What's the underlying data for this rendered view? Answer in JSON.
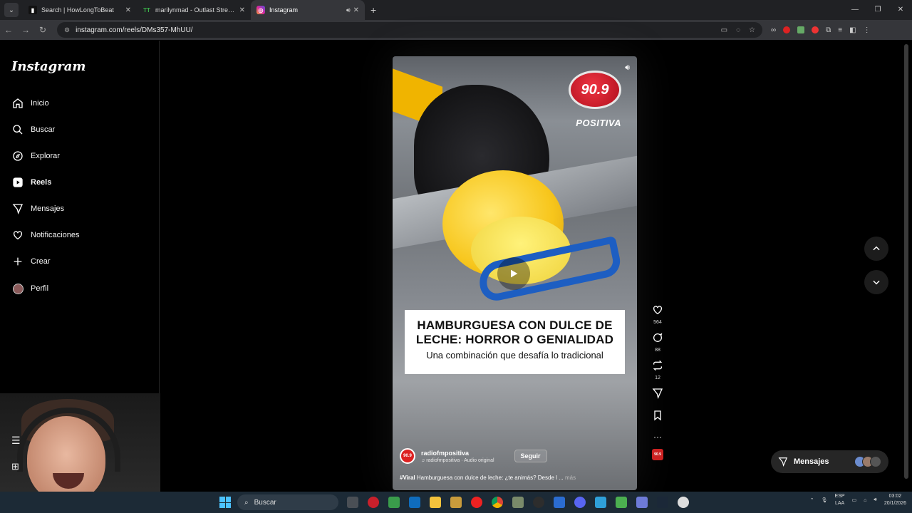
{
  "browser": {
    "tabs": [
      {
        "title": "Search | HowLongToBeat",
        "active": false,
        "fav_color": "#1a1a1a",
        "fav_glyph": "▮"
      },
      {
        "title": "marilynmad - Outlast Streams",
        "active": false,
        "fav_color": "#3bb54a",
        "fav_glyph": "TT"
      },
      {
        "title": "Instagram",
        "active": true,
        "fav_color": "#d6249f",
        "fav_glyph": "◎"
      }
    ],
    "new_tab": "+",
    "url": "instagram.com/reels/DMs357-MhUU/"
  },
  "instagram": {
    "logo": "Instagram",
    "nav": [
      {
        "label": "Inicio",
        "icon": "home-icon"
      },
      {
        "label": "Buscar",
        "icon": "search-icon"
      },
      {
        "label": "Explorar",
        "icon": "compass-icon"
      },
      {
        "label": "Reels",
        "icon": "reels-icon"
      },
      {
        "label": "Mensajes",
        "icon": "send-icon"
      },
      {
        "label": "Notificaciones",
        "icon": "heart-icon"
      },
      {
        "label": "Crear",
        "icon": "plus-icon"
      },
      {
        "label": "Perfil",
        "icon": "avatar"
      }
    ],
    "reel": {
      "badge_number": "90.9",
      "badge_name": "POSITIVA",
      "headline": "HAMBURGUESA CON DULCE DE LECHE: HORROR O GENIALIDAD",
      "headline_line1": "HAMBURGUESA CON DULCE DE",
      "headline_line2": "LECHE: HORROR O GENIALIDAD",
      "subheadline": "Una combinación que desafía lo tradicional",
      "username": "radiofmpositiva",
      "audio": "♫ radiofmpositiva · Audio original",
      "follow_label": "Seguir",
      "desc_tag": "#Viral",
      "description": "Hamburguesa con dulce de leche: ¿te animás? Desde l ...",
      "more_label": "más"
    },
    "actions": {
      "likes": "564",
      "comments": "88",
      "reposts": "12"
    },
    "messages_label": "Mensajes"
  },
  "taskbar": {
    "search_placeholder": "Buscar",
    "lang_top": "ESP",
    "lang_bottom": "LAA",
    "time": "03:02",
    "date": "20/1/2026"
  },
  "colors": {
    "ig_bg": "#000000",
    "taskbar": "#1c2a36",
    "badge_red": "#d51d2b",
    "clamp_blue": "#1d5ec2"
  }
}
